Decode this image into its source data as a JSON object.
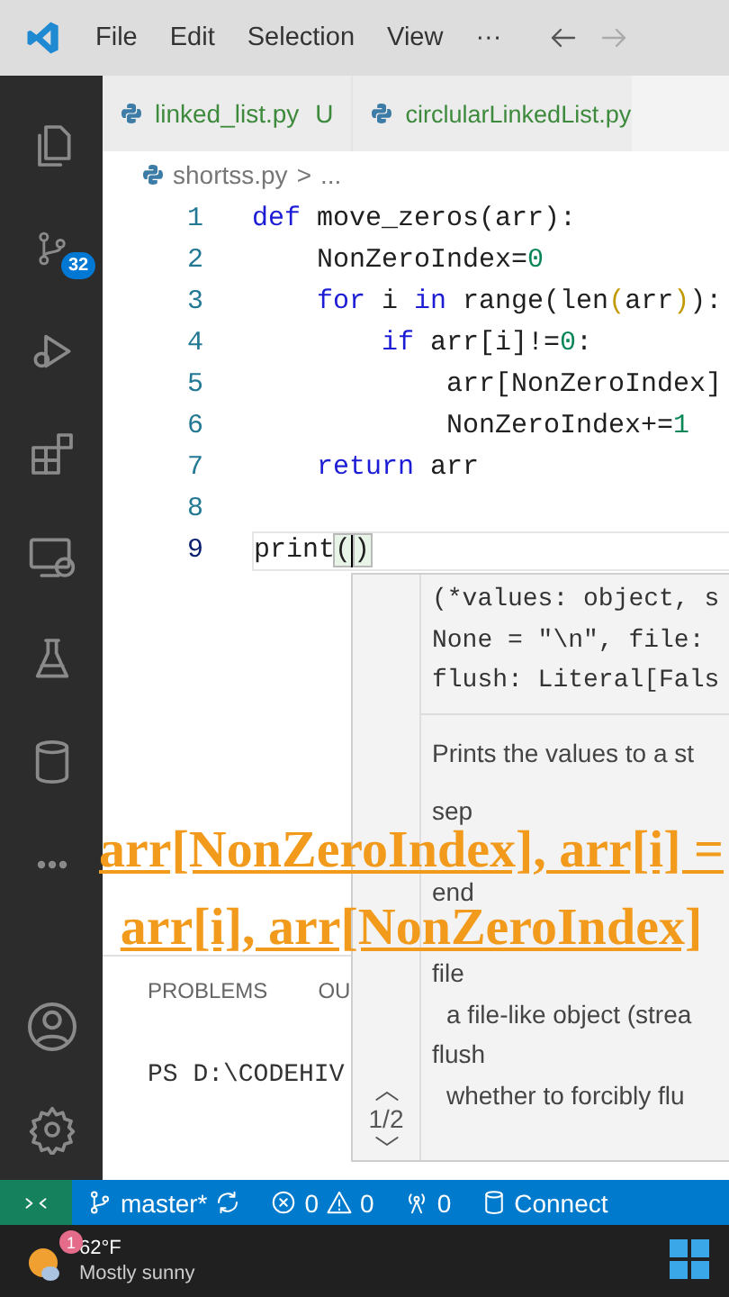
{
  "menu": [
    "File",
    "Edit",
    "Selection",
    "View",
    "···"
  ],
  "activity_bar": {
    "source_control_badge": "32"
  },
  "tabs": [
    {
      "label": "linked_list.py",
      "status": "U",
      "selected": false
    },
    {
      "label": "circlularLinkedList.py",
      "selected": false
    }
  ],
  "breadcrumb": {
    "file": "shortss.py",
    "separator": ">",
    "rest": "..."
  },
  "code_lines": [
    {
      "number": "1",
      "current": false,
      "tokens": [
        {
          "text": "def",
          "kind": "keyword"
        },
        {
          "text": " move_zeros(arr):",
          "kind": "plain"
        }
      ]
    },
    {
      "number": "2",
      "current": false,
      "tokens": [
        {
          "text": "    NonZeroIndex=",
          "kind": "plain"
        },
        {
          "text": "0",
          "kind": "number"
        }
      ]
    },
    {
      "number": "3",
      "current": false,
      "tokens": [
        {
          "text": "    for",
          "kind": "keyword"
        },
        {
          "text": " i ",
          "kind": "plain"
        },
        {
          "text": "in",
          "kind": "keyword"
        },
        {
          "text": " range(len",
          "kind": "plain"
        },
        {
          "text": "(",
          "kind": "inner_bracket"
        },
        {
          "text": "arr",
          "kind": "plain"
        },
        {
          "text": ")",
          "kind": "inner_bracket"
        },
        {
          "text": "):",
          "kind": "plain"
        }
      ]
    },
    {
      "number": "4",
      "current": false,
      "tokens": [
        {
          "text": "        if",
          "kind": "keyword"
        },
        {
          "text": " arr[i]!=",
          "kind": "plain"
        },
        {
          "text": "0",
          "kind": "number"
        },
        {
          "text": ":",
          "kind": "plain"
        }
      ]
    },
    {
      "number": "5",
      "current": false,
      "tokens": [
        {
          "text": "            arr[NonZeroIndex]",
          "kind": "plain"
        }
      ]
    },
    {
      "number": "6",
      "current": false,
      "tokens": [
        {
          "text": "            NonZeroIndex+=",
          "kind": "plain"
        },
        {
          "text": "1",
          "kind": "number"
        }
      ]
    },
    {
      "number": "7",
      "current": false,
      "tokens": [
        {
          "text": "    return",
          "kind": "keyword"
        },
        {
          "text": " arr",
          "kind": "plain"
        }
      ]
    },
    {
      "number": "8",
      "current": false
    },
    {
      "number": "9",
      "current": true,
      "tokens": [
        {
          "text": "print",
          "kind": "plain"
        },
        {
          "text": "(",
          "kind": "matched_bracket"
        },
        {
          "text": ")",
          "kind": "matched_bracket",
          "caret": true
        }
      ]
    }
  ],
  "hover": {
    "signature": [
      "(*values: object, s",
      "None = \"\\n\", file:",
      "flush: Literal[Fals"
    ],
    "description": "Prints the values to a st",
    "params": [
      {
        "name": "sep"
      },
      {
        "name": "end"
      },
      {
        "name": "file",
        "doc": "a file-like object (strea"
      },
      {
        "name": "flush",
        "doc": "whether to forcibly flu"
      }
    ],
    "pager": "1/2"
  },
  "panel": {
    "tabs": [
      "PROBLEMS",
      "OU"
    ],
    "terminal": "PS D:\\CODEHIV"
  },
  "caption": [
    "arr[NonZeroIndex], arr[i] =",
    "arr[i], arr[NonZeroIndex]"
  ],
  "status_bar": {
    "branch": "master*",
    "errors": "0",
    "warnings": "0",
    "ports": "0",
    "connect": "Connect"
  },
  "taskbar": {
    "weather_badge": "1",
    "temperature": "62°F",
    "condition": "Mostly sunny"
  }
}
